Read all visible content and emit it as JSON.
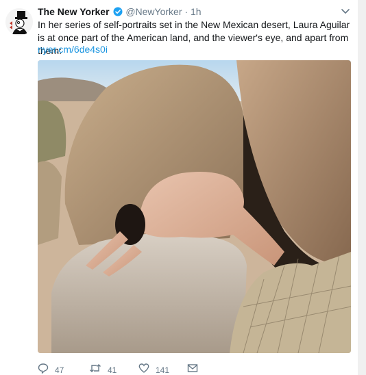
{
  "tweet": {
    "display_name": "The New Yorker",
    "handle": "@NewYorker",
    "separator": "·",
    "time": "1h",
    "text": "In her series of self-portraits set in the New Mexican desert, Laura Aguilar is at once part of the American land, and the viewer's eye, and apart from them:",
    "link": "nyer.cm/6de4s0i",
    "verified": true
  },
  "actions": {
    "replies": "47",
    "retweets": "41",
    "likes": "141"
  },
  "icons": {
    "reply": "reply-icon",
    "retweet": "retweet-icon",
    "like": "heart-icon",
    "dm": "envelope-icon",
    "verified": "verified-badge-icon",
    "menu": "chevron-down-icon"
  },
  "colors": {
    "link": "#1b95e0",
    "verified": "#1da1f2",
    "muted": "#657786"
  }
}
